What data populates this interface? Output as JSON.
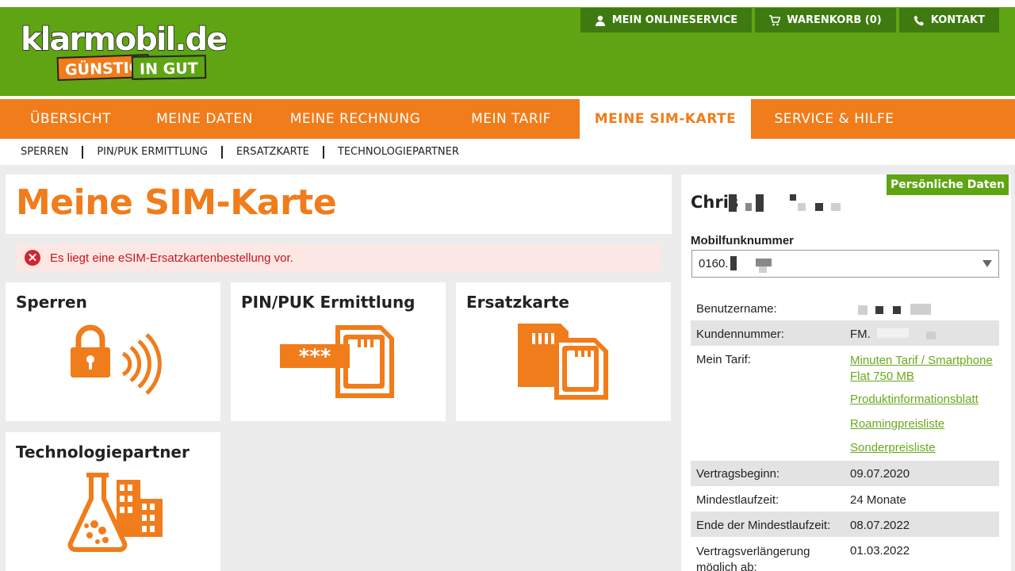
{
  "logo": {
    "word": "klarmobil.de",
    "badge_left": "GÜNSTIG",
    "badge_right": "IN GUT"
  },
  "toplinks": [
    {
      "label": "MEIN ONLINESERVICE",
      "icon": "user-icon"
    },
    {
      "label": "WARENKORB (0)",
      "icon": "cart-icon"
    },
    {
      "label": "KONTAKT",
      "icon": "phone-icon"
    }
  ],
  "nav": [
    "ÜBERSICHT",
    "MEINE DATEN",
    "MEINE RECHNUNG",
    "MEIN TARIF",
    "MEINE SIM-KARTE",
    "SERVICE & HILFE"
  ],
  "nav_active": "MEINE SIM-KARTE",
  "subnav": [
    "SPERREN",
    "PIN/PUK ERMITTLUNG",
    "ERSATZKARTE",
    "TECHNOLOGIEPARTNER"
  ],
  "page_title": "Meine SIM-Karte",
  "alert": "Es liegt eine eSIM-Ersatzkartenbestellung vor.",
  "cards": {
    "sperren": "Sperren",
    "pinpuk": "PIN/PUK Ermittlung",
    "ersatz": "Ersatzkarte",
    "tech": "Technologiepartner"
  },
  "panel": {
    "button": "Persönliche Daten",
    "name_visible": "Chris",
    "mobil_label": "Mobilfunknummer",
    "mobil_value": "0160.",
    "benutzername_label": "Benutzername:",
    "kundennummer_label": "Kundennummer:",
    "kundennummer_value": "FM.",
    "tarif_label": "Mein Tarif:",
    "tarif_link": "Minuten Tarif / Smartphone Flat 750 MB",
    "produkt_link": "Produktinformationsblatt",
    "roaming_link": "Roamingpreisliste",
    "sonder_link": "Sonderpreisliste",
    "beginn_label": "Vertragsbeginn:",
    "beginn_value": "09.07.2020",
    "laufzeit_label": "Mindestlaufzeit:",
    "laufzeit_value": "24 Monate",
    "ende_label": "Ende der Mindestlaufzeit:",
    "ende_value": "08.07.2022",
    "verl_label": "Vertragsverlängerung möglich ab:",
    "verl_value": "01.03.2022"
  },
  "colors": {
    "green": "#5fa513",
    "dark_green": "#3e7a10",
    "orange": "#f07c1b",
    "alert_red": "#c4161c"
  }
}
